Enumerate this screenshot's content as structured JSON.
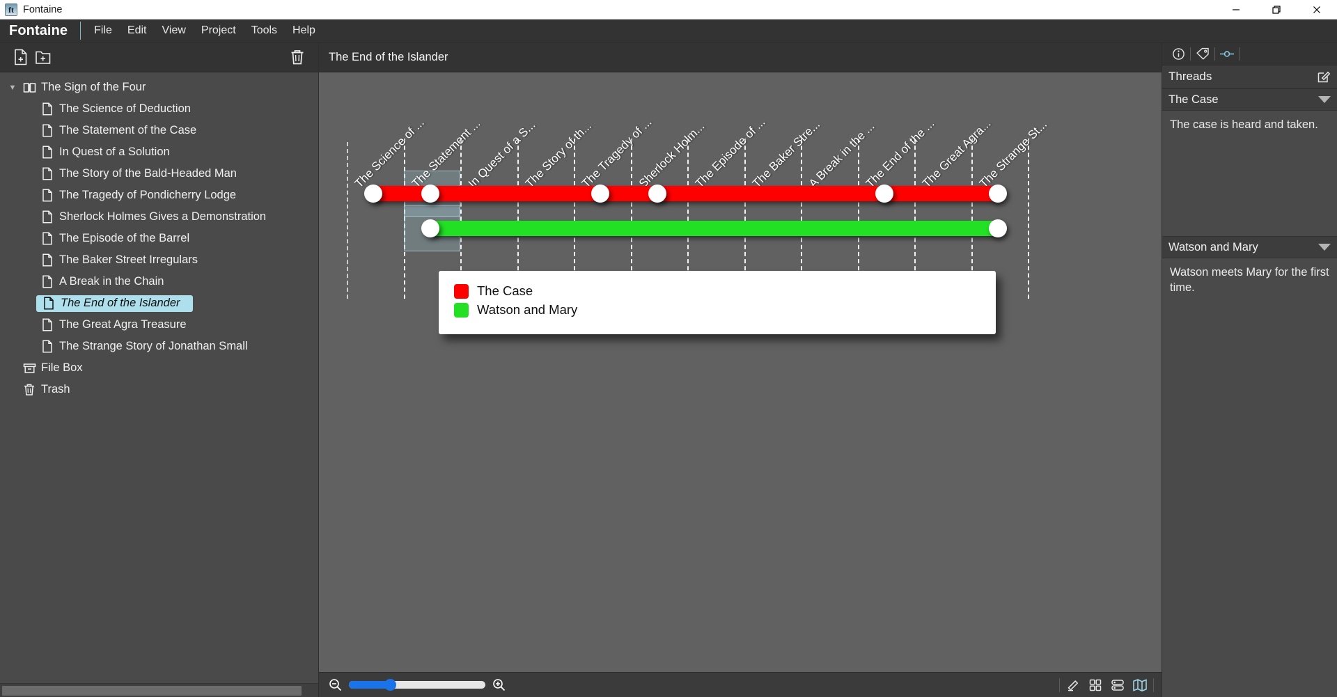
{
  "window": {
    "app_icon": "ft",
    "title": "Fontaine",
    "minimize": "minimize-icon",
    "maximize": "restore-icon",
    "close": "close-icon"
  },
  "menubar": {
    "brand": "Fontaine",
    "items": [
      "File",
      "Edit",
      "View",
      "Project",
      "Tools",
      "Help"
    ]
  },
  "sidebar": {
    "toolbar": {
      "new_document": "new-document-icon",
      "new_folder": "new-folder-icon",
      "trash": "trash-icon"
    },
    "tree": [
      {
        "label": "The Sign of the Four",
        "icon": "book-icon",
        "level": 0,
        "expandable": true,
        "selected": false
      },
      {
        "label": "The Science of Deduction",
        "icon": "document-icon",
        "level": 1,
        "selected": false
      },
      {
        "label": "The Statement of the Case",
        "icon": "document-icon",
        "level": 1,
        "selected": false
      },
      {
        "label": "In Quest of a Solution",
        "icon": "document-icon",
        "level": 1,
        "selected": false
      },
      {
        "label": "The Story of the Bald-Headed Man",
        "icon": "document-icon",
        "level": 1,
        "selected": false
      },
      {
        "label": "The Tragedy of Pondicherry Lodge",
        "icon": "document-icon",
        "level": 1,
        "selected": false
      },
      {
        "label": "Sherlock Holmes Gives a Demonstration",
        "icon": "document-icon",
        "level": 1,
        "selected": false
      },
      {
        "label": "The Episode of the Barrel",
        "icon": "document-icon",
        "level": 1,
        "selected": false
      },
      {
        "label": "The Baker Street Irregulars",
        "icon": "document-icon",
        "level": 1,
        "selected": false
      },
      {
        "label": "A Break in the Chain",
        "icon": "document-icon",
        "level": 1,
        "selected": false
      },
      {
        "label": "The End of the Islander",
        "icon": "document-icon",
        "level": 1,
        "selected": true
      },
      {
        "label": "The Great Agra Treasure",
        "icon": "document-icon",
        "level": 1,
        "selected": false
      },
      {
        "label": "The Strange Story of Jonathan Small",
        "icon": "document-icon",
        "level": 1,
        "selected": false
      },
      {
        "label": "File Box",
        "icon": "filebox-icon",
        "level": "0b",
        "selected": false
      },
      {
        "label": "Trash",
        "icon": "trash-icon",
        "level": "0b",
        "selected": false
      }
    ]
  },
  "editor": {
    "doc_title": "The End of the Islander"
  },
  "chart_data": {
    "type": "timeline",
    "title": "",
    "columns": [
      "The Science of ...",
      "The Statement ...",
      "In Quest of a S...",
      "The Story of th...",
      "The Tragedy of ...",
      "Sherlock Holm...",
      "The Episode of ...",
      "The Baker Stre...",
      "A Break in the ...",
      "The End of the ...",
      "The Great Agra...",
      "The Strange St..."
    ],
    "column_full_names": [
      "The Science of Deduction",
      "The Statement of the Case",
      "In Quest of a Solution",
      "The Story of the Bald-Headed Man",
      "The Tragedy of Pondicherry Lodge",
      "Sherlock Holmes Gives a Demonstration",
      "The Episode of the Barrel",
      "The Baker Street Irregulars",
      "A Break in the Chain",
      "The End of the Islander",
      "The Great Agra Treasure",
      "The Strange Story of Jonathan Small"
    ],
    "selected_column_index": 1,
    "series": [
      {
        "name": "The Case",
        "color": "#ff0000",
        "start_column": 1,
        "end_column": 12,
        "marker_columns": [
          1,
          2,
          5,
          6,
          10,
          12
        ]
      },
      {
        "name": "Watson and Mary",
        "color": "#22e024",
        "start_column": 2,
        "end_column": 12,
        "marker_columns": [
          2,
          12
        ]
      }
    ],
    "legend": {
      "position": "center",
      "entries": [
        {
          "label": "The Case",
          "color": "#ff0000"
        },
        {
          "label": "Watson and Mary",
          "color": "#22e024"
        }
      ]
    }
  },
  "bottombar": {
    "zoom_out": "zoom-out-icon",
    "zoom_in": "zoom-in-icon",
    "zoom_value": 30,
    "views": [
      {
        "name": "edit-view",
        "icon": "pencil-icon",
        "active": false
      },
      {
        "name": "cards-view",
        "icon": "grid-icon",
        "active": false
      },
      {
        "name": "outline-view",
        "icon": "list-icon",
        "active": false
      },
      {
        "name": "map-view",
        "icon": "map-icon",
        "active": true
      }
    ]
  },
  "inspector": {
    "tools": [
      {
        "name": "info-tab",
        "icon": "info-icon",
        "active": false
      },
      {
        "name": "tags-tab",
        "icon": "tag-icon",
        "active": false
      },
      {
        "name": "threads-tab",
        "icon": "thread-icon",
        "active": true
      }
    ],
    "panel_title": "Threads",
    "edit_action": "edit-threads-icon",
    "threads": [
      {
        "name": "The Case",
        "description": "The case is heard and taken."
      },
      {
        "name": "Watson and Mary",
        "description": "Watson meets Mary for the first time."
      }
    ]
  }
}
